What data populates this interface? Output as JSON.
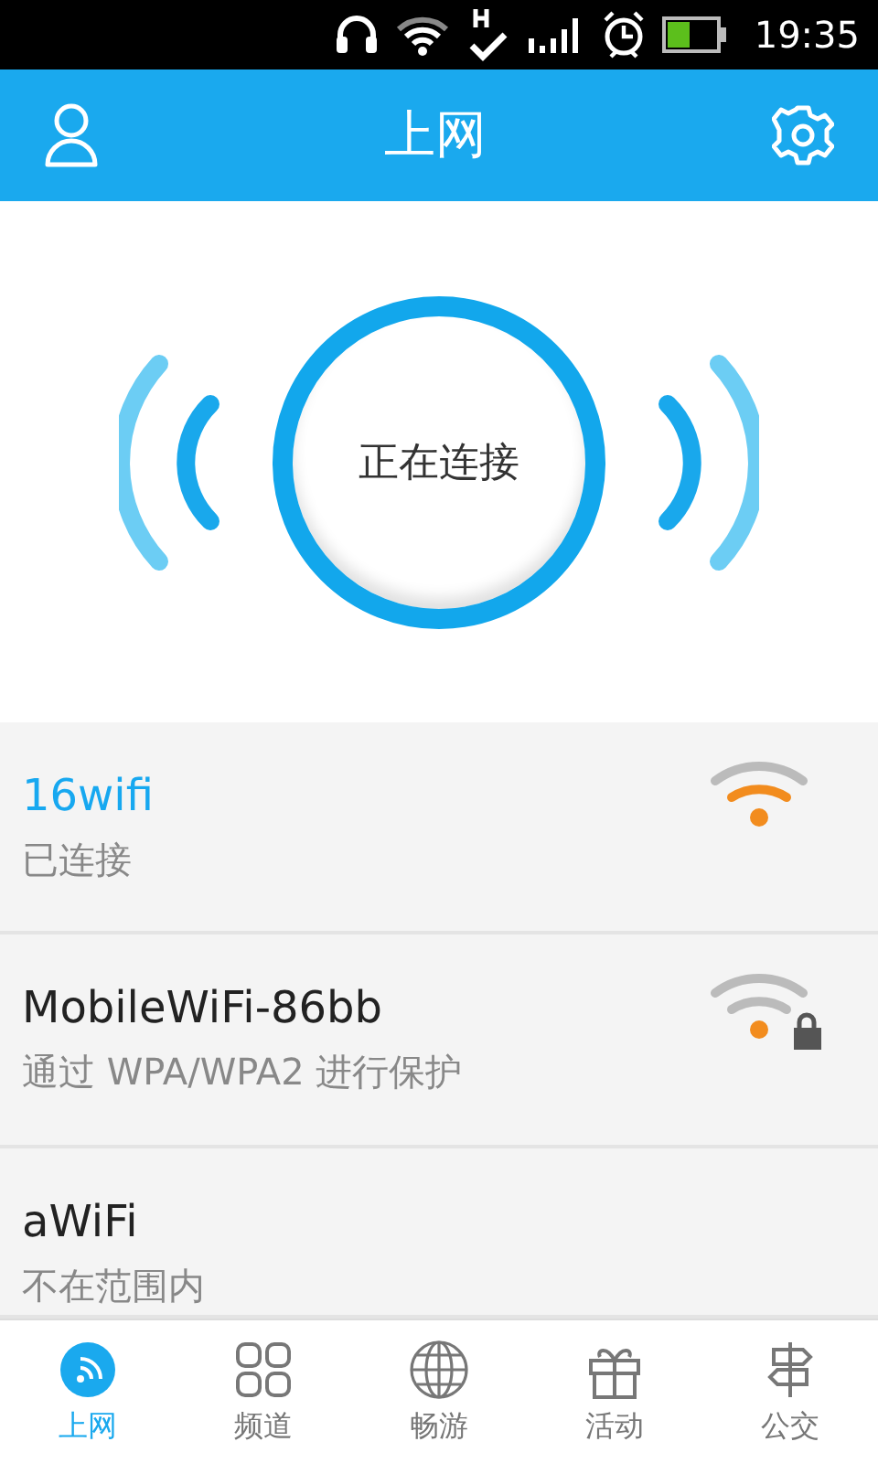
{
  "status_bar": {
    "time": "19:35"
  },
  "header": {
    "title": "上网"
  },
  "hero": {
    "status": "正在连接"
  },
  "networks": [
    {
      "name": "16wifi",
      "detail": "已连接",
      "connected": true,
      "kind": "strong",
      "locked": false
    },
    {
      "name": "MobileWiFi-86bb",
      "detail": "通过 WPA/WPA2 进行保护",
      "connected": false,
      "kind": "weak",
      "locked": true
    },
    {
      "name": "aWiFi",
      "detail": "不在范围内",
      "connected": false,
      "kind": "out_of_range",
      "locked": false
    }
  ],
  "tabs": [
    {
      "label": "上网",
      "selected": true
    },
    {
      "label": "频道",
      "selected": false
    },
    {
      "label": "畅游",
      "selected": false
    },
    {
      "label": "活动",
      "selected": false
    },
    {
      "label": "公交",
      "selected": false
    }
  ]
}
